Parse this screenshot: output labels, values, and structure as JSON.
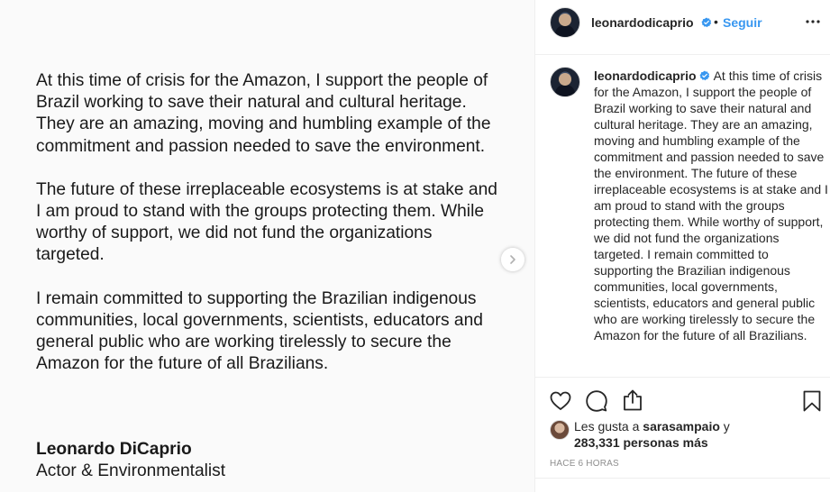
{
  "post_image": {
    "paragraphs": [
      "At this time of crisis for the Amazon, I support the people of Brazil working to save their natural and cultural heritage. They are an amazing, moving and humbling example of the commitment and passion needed to save the environment.",
      "The future of these irreplaceable ecosystems is at stake and I am proud to stand with the groups protecting them. While worthy of support, we did not fund the organizations targeted.",
      "I remain committed to supporting the Brazilian indigenous communities, local governments, scientists, educators and general public who are working tirelessly to secure the Amazon for the future of all Brazilians."
    ],
    "signature_name": "Leonardo DiCaprio",
    "signature_title": "Actor & Environmentalist",
    "next_icon": "chevron-right-icon"
  },
  "header": {
    "username": "leonardodicaprio",
    "dot": "•",
    "follow_label": "Seguir",
    "verified_icon": "verified-badge-icon",
    "more_icon": "more-options-icon"
  },
  "caption": {
    "username": "leonardodicaprio",
    "text": "At this time of crisis for the Amazon, I support the people of Brazil working to save their natural and cultural heritage. They are an amazing, moving and humbling example of the commitment and passion needed to save the environment. The future of these irreplaceable ecosystems is at stake and I am proud to stand with the groups protecting them. While worthy of support, we did not fund the organizations targeted. I remain committed to supporting the Brazilian indigenous communities, local governments, scientists, educators and general public who are working tirelessly to secure the Amazon for the future of all Brazilians."
  },
  "actions": {
    "like_icon": "heart-icon",
    "comment_icon": "comment-icon",
    "share_icon": "share-icon",
    "save_icon": "bookmark-icon"
  },
  "likes": {
    "prefix": "Les gusta a",
    "user": "sarasampaio",
    "connector": "y",
    "count": "283,331 personas más"
  },
  "timestamp": "Hace 6 horas",
  "colors": {
    "accent": "#3897f0",
    "text": "#262626",
    "muted": "#8e8e8e",
    "border": "#efefef"
  }
}
